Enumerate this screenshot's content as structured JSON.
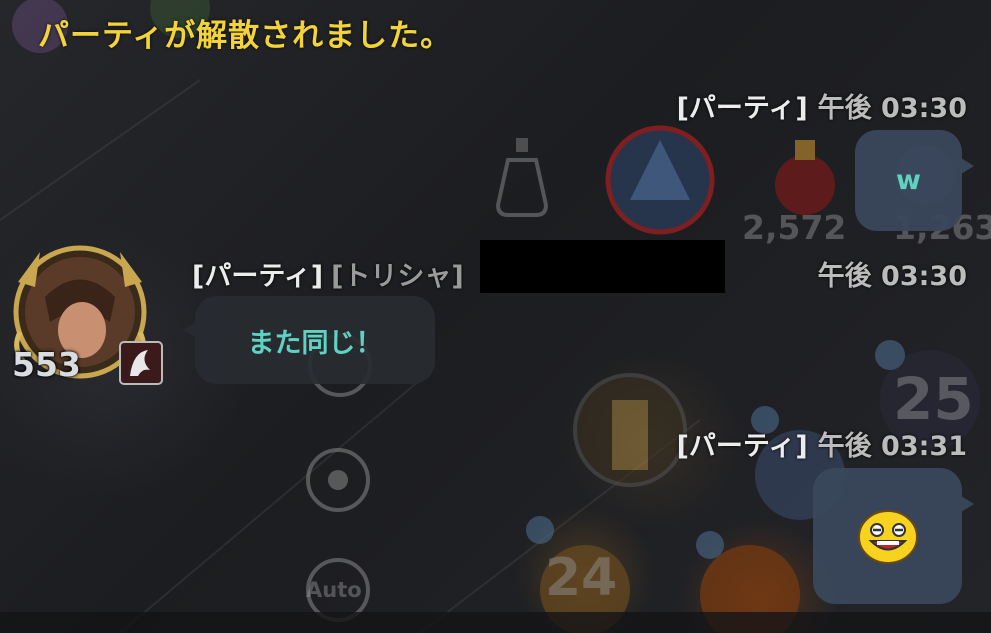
{
  "system_message": "パーティが解散されました。",
  "messages": [
    {
      "channel": "[パーティ]",
      "time": "午後 03:30",
      "text": "w",
      "type": "mine"
    },
    {
      "channel": "[パーティ]",
      "sender": "[トリシャ]",
      "time": "午後 03:30",
      "text": "また同じ！",
      "type": "other",
      "level": "553"
    },
    {
      "channel": "[パーティ]",
      "time": "午後 03:31",
      "type": "mine",
      "emoji": "grinning-emoticon"
    }
  ],
  "background": {
    "numbers": [
      "2,572",
      "1,263",
      "25",
      "24"
    ],
    "auto_label": "Auto"
  },
  "colors": {
    "system_text": "#f2d43a",
    "chat_text": "#5fd2c2",
    "header_text": "#e8e8e8"
  }
}
